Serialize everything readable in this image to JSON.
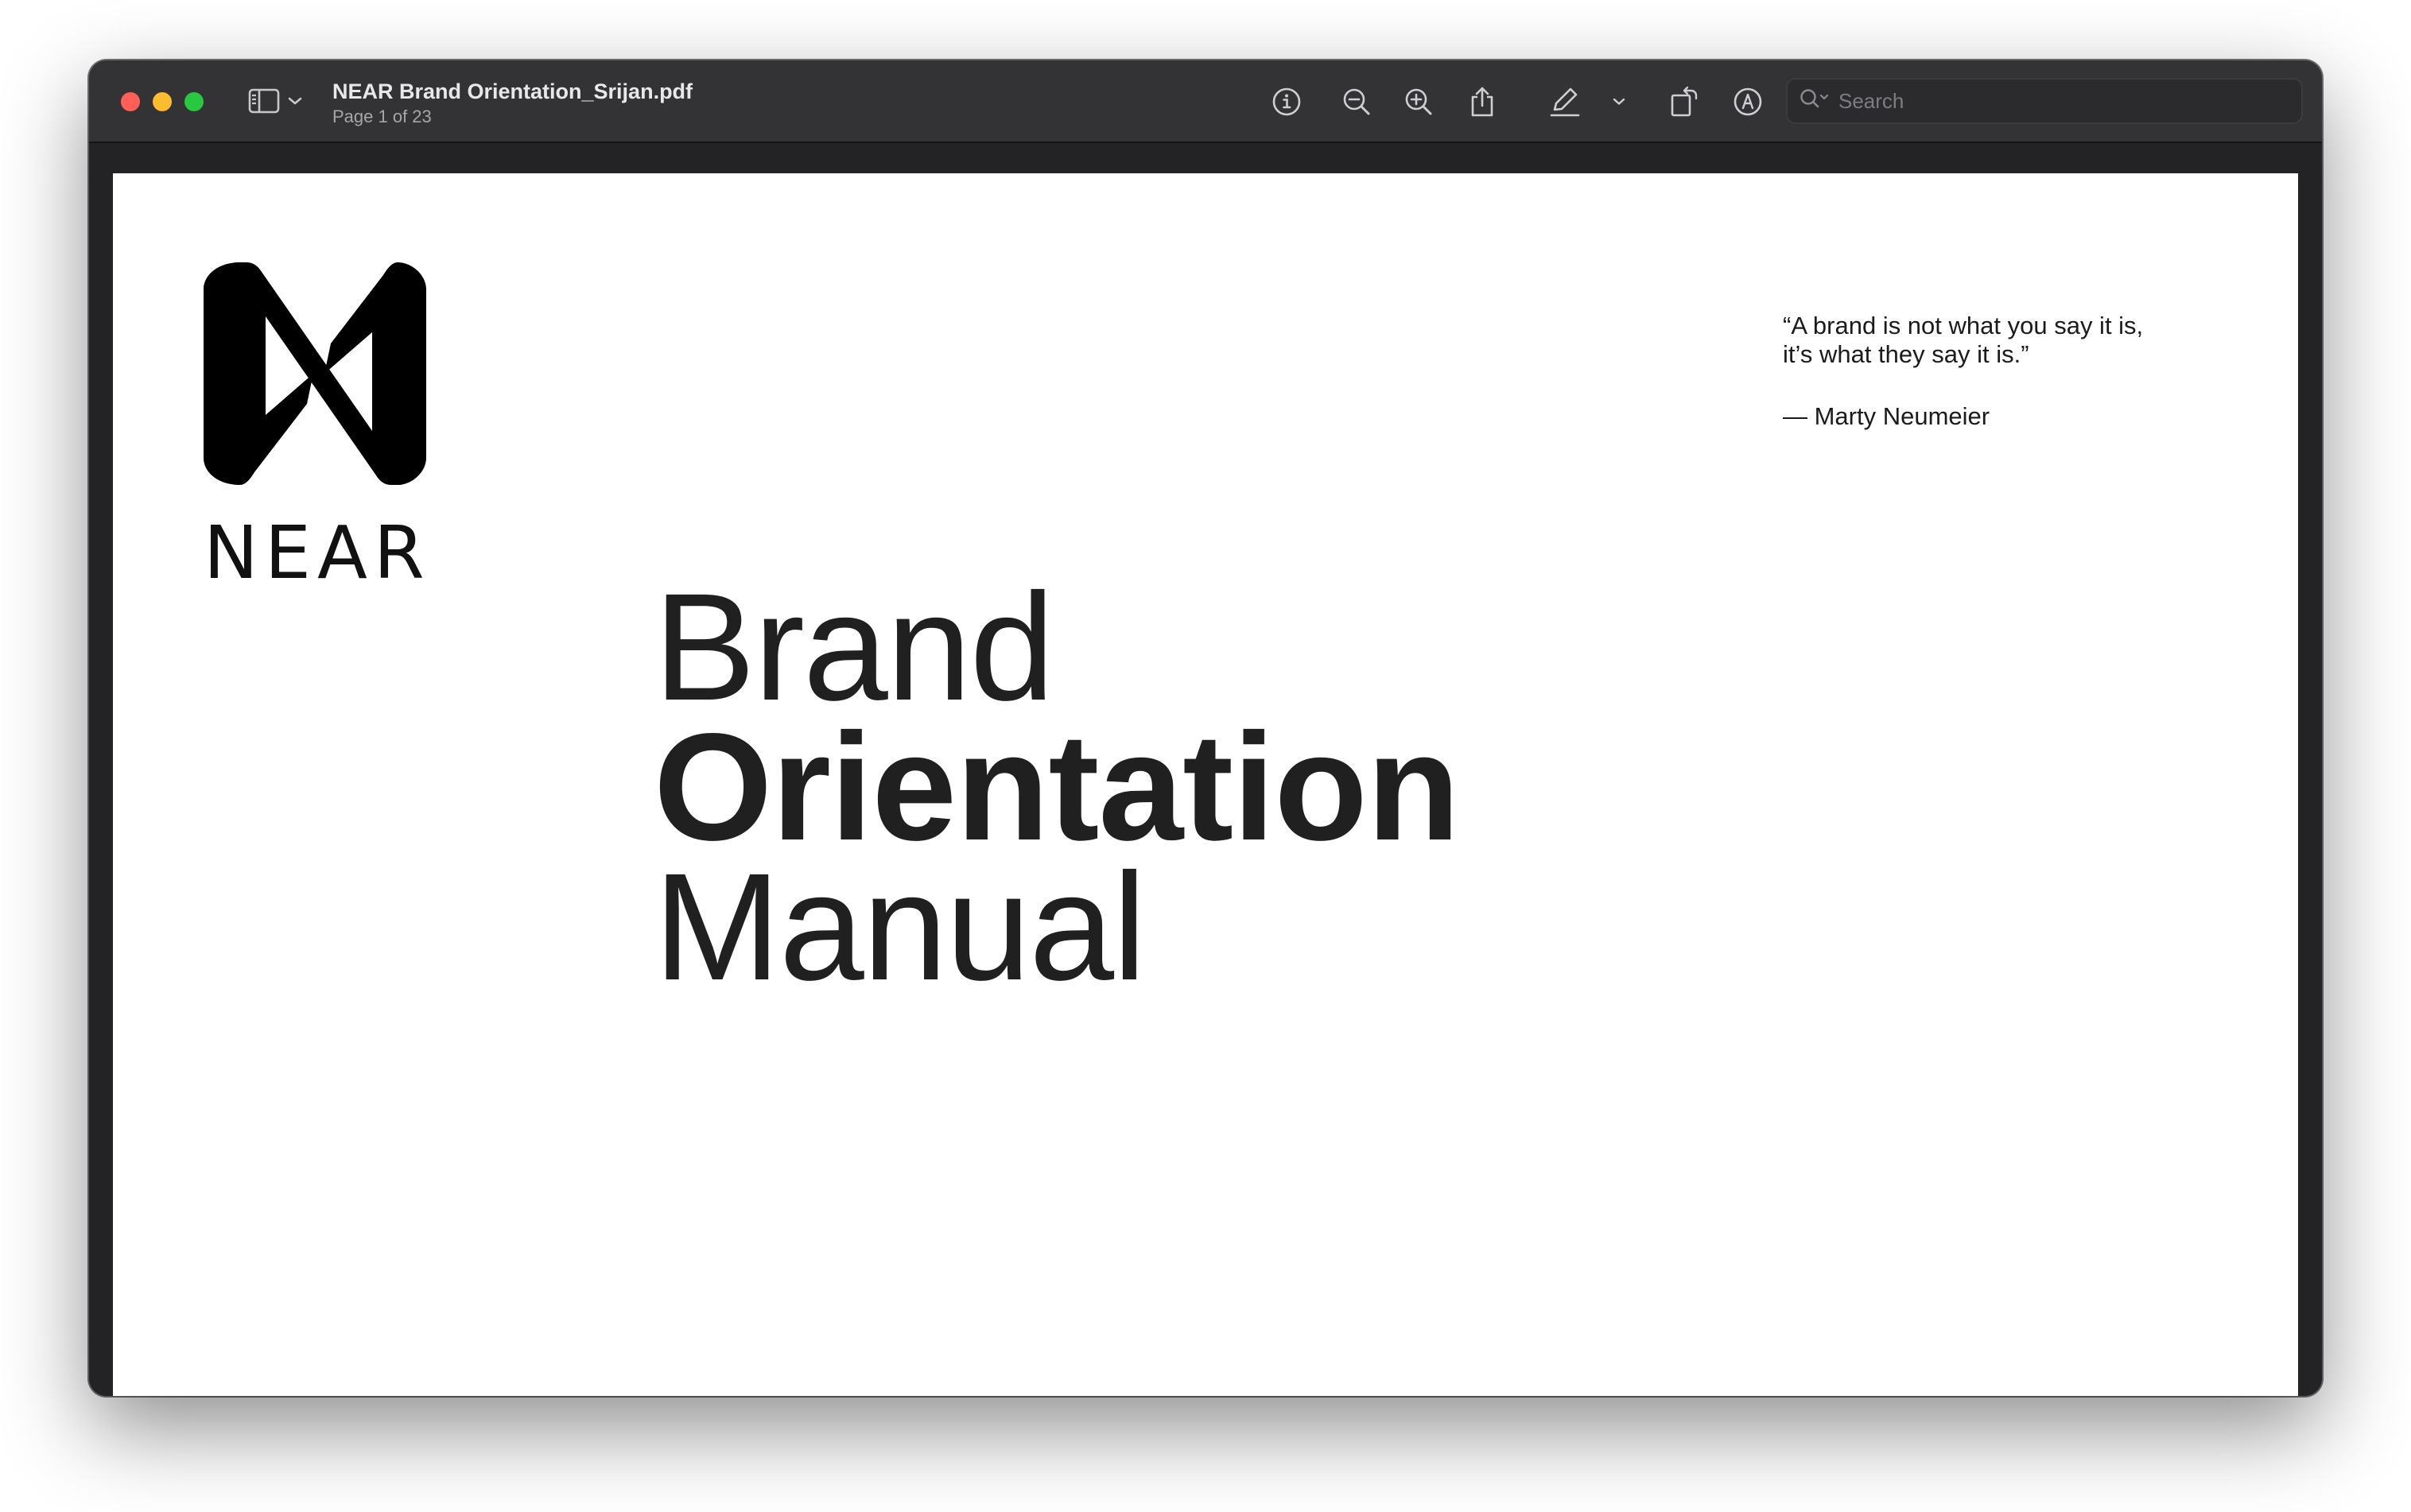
{
  "window": {
    "title": "NEAR Brand Orientation_Srijan.pdf",
    "subtitle": "Page 1 of 23"
  },
  "toolbar": {
    "icons": [
      "sidebar-icon",
      "chevron-down-icon",
      "info-icon",
      "zoom-out-icon",
      "zoom-in-icon",
      "share-icon",
      "highlight-pen-icon",
      "chevron-down-icon",
      "rotate-icon",
      "markup-icon",
      "form-fill-icon"
    ],
    "search_placeholder": "Search"
  },
  "page": {
    "logo_word": "NEAR",
    "title_line1": "Brand",
    "title_line2": "Orientation",
    "title_line3": "Manual",
    "quote_line1": "“A brand is not what you say it is,",
    "quote_line2": "it’s what they say it is.”",
    "quote_author": "— Marty Neumeier"
  },
  "colors": {
    "titlebar": "#333336",
    "close": "#ff5f57",
    "minimize": "#febc2e",
    "maximize": "#28c840",
    "page_text": "#202020"
  }
}
